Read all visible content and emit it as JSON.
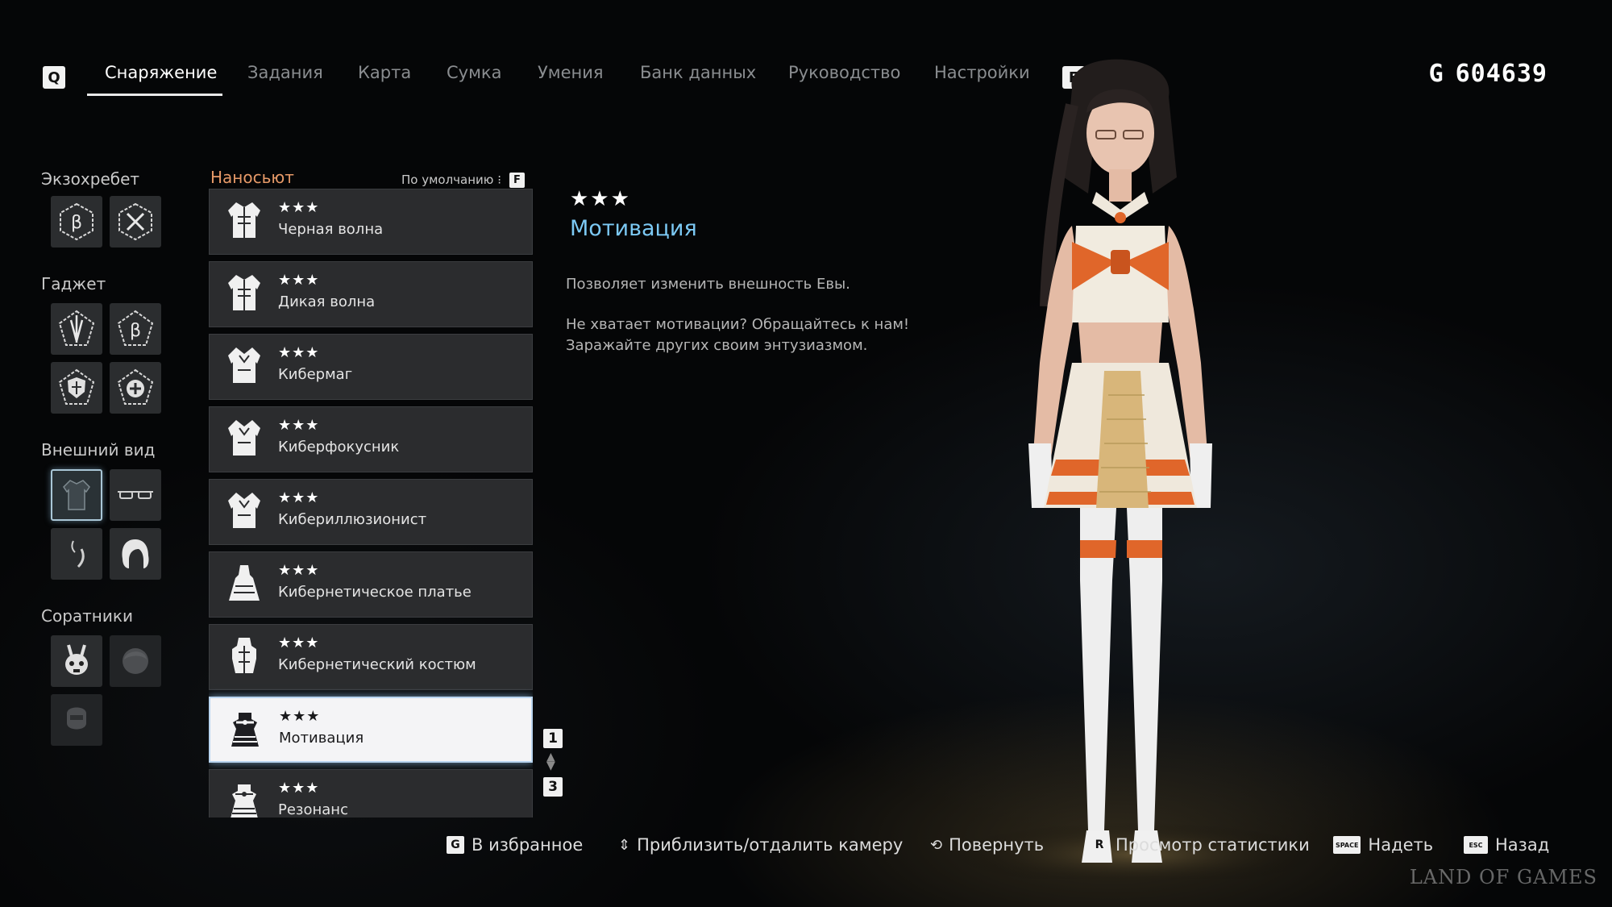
{
  "top_nav": {
    "left_key": "Q",
    "right_key": "E",
    "tabs": [
      {
        "label": "Снаряжение",
        "active": true
      },
      {
        "label": "Задания",
        "active": false
      },
      {
        "label": "Карта",
        "active": false
      },
      {
        "label": "Сумка",
        "active": false
      },
      {
        "label": "Умения",
        "active": false
      },
      {
        "label": "Банк данных",
        "active": false
      },
      {
        "label": "Руководство",
        "active": false
      },
      {
        "label": "Настройки",
        "active": false
      }
    ],
    "currency_symbol": "G",
    "currency_value": "604639"
  },
  "categories": {
    "exospine": {
      "label": "Экзохребет",
      "slots": [
        "exospine-beta-icon",
        "exospine-x-icon"
      ]
    },
    "gadget": {
      "label": "Гаджет",
      "slots": [
        "gadget-spear-icon",
        "gadget-beta-icon",
        "gadget-shield-icon",
        "gadget-heal-icon"
      ]
    },
    "appearance": {
      "label": "Внешний вид",
      "slots": [
        "outfit-icon",
        "glasses-icon",
        "earring-icon",
        "hair-icon"
      ],
      "selected": 0
    },
    "companions": {
      "label": "Соратники",
      "slots": [
        "drone-icon",
        "companion-face-icon",
        "companion-helmet-icon"
      ]
    }
  },
  "list": {
    "title": "Наносьют",
    "sort_label": "По умолчанию",
    "sort_key": "F",
    "items": [
      {
        "stars": "★★★",
        "name": "Черная волна"
      },
      {
        "stars": "★★★",
        "name": "Дикая волна"
      },
      {
        "stars": "★★★",
        "name": "Кибермаг"
      },
      {
        "stars": "★★★",
        "name": "Киберфокусник"
      },
      {
        "stars": "★★★",
        "name": "Кибериллюзионист"
      },
      {
        "stars": "★★★",
        "name": "Кибернетическое платье"
      },
      {
        "stars": "★★★",
        "name": "Кибернетический костюм"
      },
      {
        "stars": "★★★",
        "name": "Мотивация"
      },
      {
        "stars": "★★★",
        "name": "Резонанс"
      }
    ],
    "selected_index": 7,
    "pager_up_key": "1",
    "pager_down_key": "3"
  },
  "detail": {
    "stars": "★★★",
    "title": "Мотивация",
    "desc1": "Позволяет изменить внешность Евы.",
    "desc2": "Не хватает мотивации? Обращайтесь к нам!",
    "desc3": "Заражайте других своим энтузиазмом."
  },
  "hints": [
    {
      "key": "G",
      "label": "В избранное"
    },
    {
      "key": "zoom-icon",
      "label": "Приблизить/отдалить камеру"
    },
    {
      "key": "rotate-icon",
      "label": "Повернуть"
    },
    {
      "key": "R",
      "label": "Просмотр статистики"
    },
    {
      "key": "SPACE",
      "label": "Надеть"
    },
    {
      "key": "ESC",
      "label": "Назад"
    }
  ],
  "watermark": "LAND OF GAMES",
  "colors": {
    "accent_blue": "#7cc9f4",
    "list_title_orange": "#e79a68",
    "outfit_orange": "#e0662a"
  }
}
